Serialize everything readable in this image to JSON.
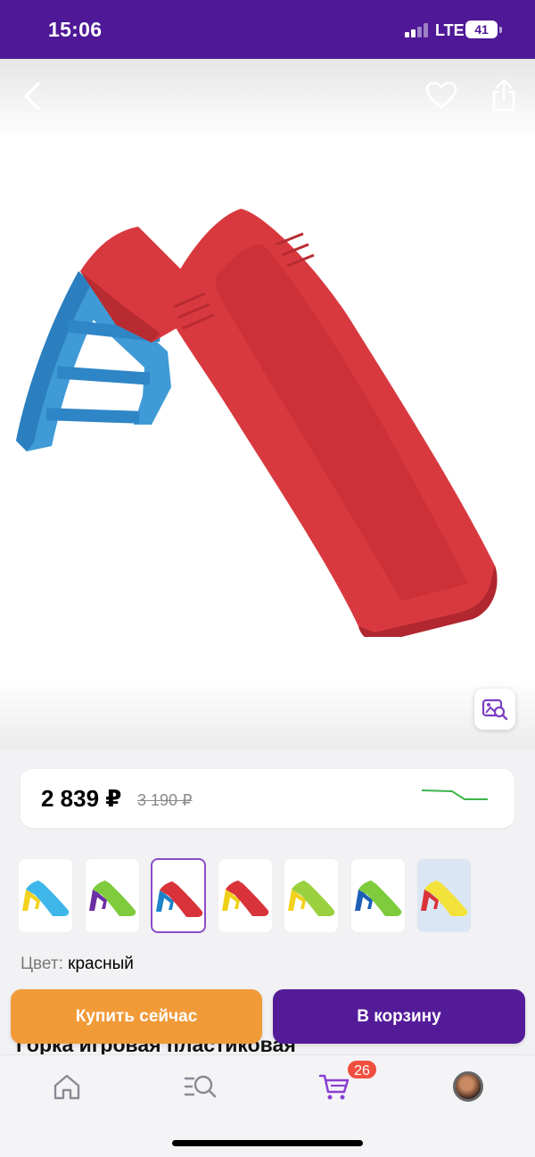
{
  "status_bar": {
    "time": "15:06",
    "network": "LTE",
    "battery": "41"
  },
  "colors": {
    "brand": "#4e1896",
    "buy_now": "#f19a38",
    "cart_button": "#541b99",
    "badge": "#f04f3f",
    "price_trend": "#3ab54a"
  },
  "gallery": {
    "icons": [
      "chevron-left-icon",
      "heart-icon",
      "share-icon",
      "image-search-icon"
    ],
    "image": "red-blue-plastic-slide"
  },
  "price": {
    "current": "2 839 ₽",
    "old": "3 190 ₽"
  },
  "variants": [
    {
      "slide": "#3eb6ea",
      "ladder": "#f2d21d"
    },
    {
      "slide": "#7ecb3c",
      "ladder": "#6d2fa6"
    },
    {
      "slide": "#d8333a",
      "ladder": "#1d83c9",
      "selected": true
    },
    {
      "slide": "#d8333a",
      "ladder": "#f0d015"
    },
    {
      "slide": "#9bd13f",
      "ladder": "#f2d21d"
    },
    {
      "slide": "#7ecb3c",
      "ladder": "#1d5fb8"
    },
    {
      "slide": "#f2e23a",
      "ladder": "#d8333a",
      "info_image": true
    }
  ],
  "color": {
    "label": "Цвет:",
    "value": "красный"
  },
  "actions": {
    "buy_now": "Купить сейчас",
    "add_to_cart": "В корзину"
  },
  "product": {
    "title": "Горка игровая пластиковая"
  },
  "tab_bar": {
    "tabs": [
      "home-icon",
      "catalog-search-icon",
      "cart-icon",
      "profile-avatar"
    ],
    "cart_count": "26"
  }
}
